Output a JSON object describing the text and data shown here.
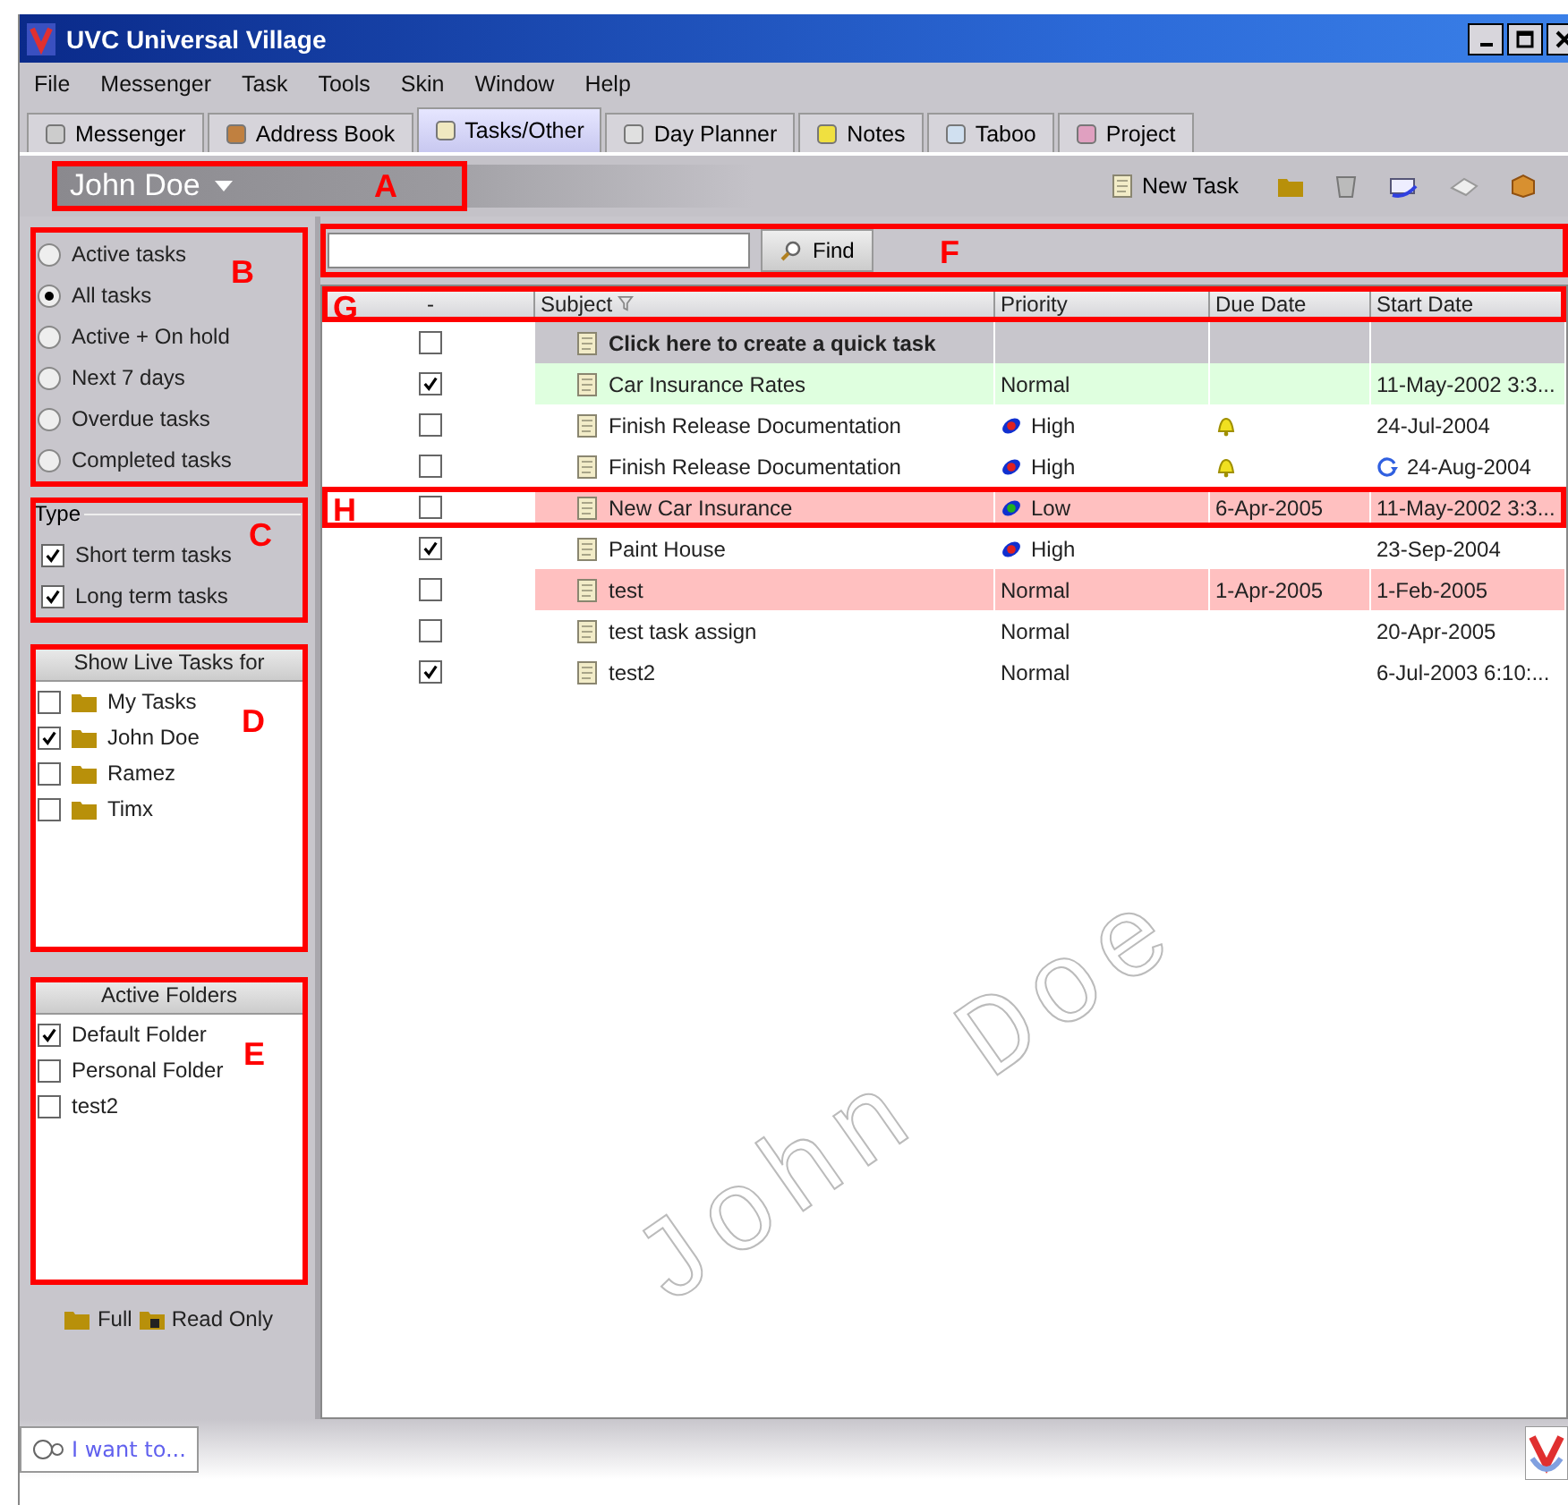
{
  "window": {
    "title": "UVC Universal Village"
  },
  "menu": [
    "File",
    "Messenger",
    "Task",
    "Tools",
    "Skin",
    "Window",
    "Help"
  ],
  "tabs": [
    {
      "label": "Messenger",
      "selected": false
    },
    {
      "label": "Address Book",
      "selected": false
    },
    {
      "label": "Tasks/Other",
      "selected": true
    },
    {
      "label": "Day Planner",
      "selected": false
    },
    {
      "label": "Notes",
      "selected": false
    },
    {
      "label": "Taboo",
      "selected": false
    },
    {
      "label": "Project",
      "selected": false
    }
  ],
  "user_bar": {
    "name": "John Doe",
    "callout": "A"
  },
  "toolbar": {
    "new_task": "New Task"
  },
  "filters": {
    "callout": "B",
    "options": [
      {
        "label": "Active tasks",
        "selected": false
      },
      {
        "label": "All tasks",
        "selected": true
      },
      {
        "label": "Active + On hold",
        "selected": false
      },
      {
        "label": "Next 7 days",
        "selected": false
      },
      {
        "label": "Overdue tasks",
        "selected": false
      },
      {
        "label": "Completed tasks",
        "selected": false
      }
    ]
  },
  "type": {
    "title": "Type",
    "callout": "C",
    "items": [
      {
        "label": "Short term tasks",
        "checked": true
      },
      {
        "label": "Long term tasks",
        "checked": true
      }
    ]
  },
  "live_tasks": {
    "title": "Show Live Tasks for",
    "callout": "D",
    "items": [
      {
        "label": "My Tasks",
        "checked": false
      },
      {
        "label": "John Doe",
        "checked": true
      },
      {
        "label": "Ramez",
        "checked": false
      },
      {
        "label": "Timx",
        "checked": false
      }
    ]
  },
  "active_folders": {
    "title": "Active Folders",
    "callout": "E",
    "items": [
      {
        "label": "Default Folder",
        "checked": true
      },
      {
        "label": "Personal Folder",
        "checked": false
      },
      {
        "label": "test2",
        "checked": false
      }
    ]
  },
  "legend": [
    "Full",
    "Read Only"
  ],
  "search": {
    "button": "Find",
    "callout": "F"
  },
  "table": {
    "callout": "G",
    "watermark": "John Doe",
    "columns": [
      "-",
      "Subject",
      "Priority",
      "Due Date",
      "Start Date"
    ],
    "rows": [
      {
        "kind": "quick",
        "checked": false,
        "subject": "Click here to create a quick task"
      },
      {
        "kind": "task",
        "checked": true,
        "subject": "Car Insurance Rates",
        "priority": "Normal",
        "start": "11-May-2002 3:3...",
        "color": "#dfffdf"
      },
      {
        "kind": "task",
        "checked": false,
        "subject": "Finish Release Documentation",
        "priority": "High",
        "priority_icon": true,
        "urgent": true,
        "reminder": true,
        "start": "24-Jul-2004"
      },
      {
        "kind": "task",
        "checked": false,
        "subject": "Finish Release Documentation",
        "priority": "High",
        "priority_icon": true,
        "urgent": true,
        "reminder": true,
        "recurring": true,
        "start": "24-Aug-2004"
      },
      {
        "kind": "task",
        "checked": false,
        "subject": "New Car Insurance",
        "priority": "Low",
        "priority_icon": true,
        "urgent": false,
        "due": "6-Apr-2005",
        "start": "11-May-2002 3:3...",
        "color": "#ffc0c0",
        "callout": "H"
      },
      {
        "kind": "task",
        "checked": true,
        "subject": "Paint House",
        "priority": "High",
        "priority_icon": true,
        "urgent": true,
        "start": "23-Sep-2004"
      },
      {
        "kind": "task",
        "checked": false,
        "subject": "test",
        "priority": "Normal",
        "due": "1-Apr-2005",
        "start": "1-Feb-2005",
        "color": "#ffc0c0"
      },
      {
        "kind": "task",
        "checked": false,
        "subject": "test task assign",
        "priority": "Normal",
        "start": "20-Apr-2005"
      },
      {
        "kind": "task",
        "checked": true,
        "subject": "test2",
        "priority": "Normal",
        "start": "6-Jul-2003 6:10:..."
      }
    ]
  },
  "status_bar": {
    "button": "I want to..."
  }
}
